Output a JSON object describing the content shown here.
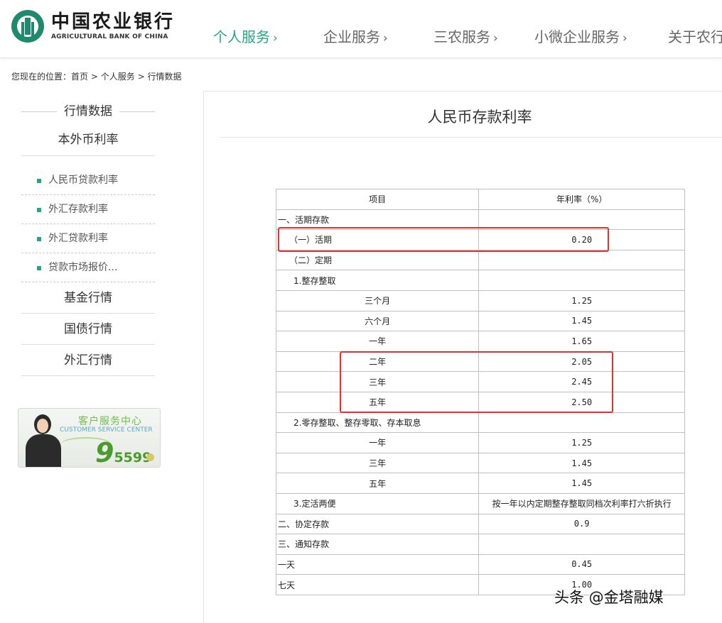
{
  "brand": {
    "name_cn": "中国农业银行",
    "name_en": "AGRICULTURAL BANK OF CHINA",
    "primary_color": "#27a38a",
    "logo_color": "#1f8a6d"
  },
  "nav": {
    "items": [
      {
        "label": "个人服务",
        "active": true
      },
      {
        "label": "企业服务",
        "active": false
      },
      {
        "label": "三农服务",
        "active": false
      },
      {
        "label": "小微企业服务",
        "active": false
      },
      {
        "label": "关于农行",
        "active": false
      }
    ],
    "chevron": "›"
  },
  "breadcrumb": {
    "prefix": "您现在的位置：",
    "path": [
      "首页",
      "个人服务",
      "行情数据"
    ],
    "separator": ">"
  },
  "sidebar": {
    "title": "行情数据",
    "section": "本外币利率",
    "sub_items": [
      "人民币贷款利率",
      "外汇存款利率",
      "外汇贷款利率",
      "贷款市场报价..."
    ],
    "categories": [
      "基金行情",
      "国债行情",
      "外汇行情"
    ]
  },
  "banner": {
    "title": "客户服务中心",
    "subtitle": "CUSTOMER SERVICE CENTER",
    "hotline_big": "9",
    "hotline_rest": "5599"
  },
  "main": {
    "title": "人民币存款利率"
  },
  "rates_table": {
    "headers": [
      "项目",
      "年利率（%）"
    ],
    "rows": [
      {
        "item": "一、活期存款",
        "rate": "",
        "level": 0
      },
      {
        "item": "（一）活期",
        "rate": "0.20",
        "level": 1
      },
      {
        "item": "（二）定期",
        "rate": "",
        "level": 1
      },
      {
        "item": "1.整存整取",
        "rate": "",
        "level": 2
      },
      {
        "item": "三个月",
        "rate": "1.25",
        "level": 3
      },
      {
        "item": "六个月",
        "rate": "1.45",
        "level": 3
      },
      {
        "item": "一年",
        "rate": "1.65",
        "level": 3
      },
      {
        "item": "二年",
        "rate": "2.05",
        "level": 3
      },
      {
        "item": "三年",
        "rate": "2.45",
        "level": 3
      },
      {
        "item": "五年",
        "rate": "2.50",
        "level": 3
      },
      {
        "item": "2.零存整取、整存零取、存本取息",
        "rate": "",
        "level": 2
      },
      {
        "item": "一年",
        "rate": "1.25",
        "level": 3
      },
      {
        "item": "三年",
        "rate": "1.45",
        "level": 3
      },
      {
        "item": "五年",
        "rate": "1.45",
        "level": 3
      },
      {
        "item": "3.定活两便",
        "rate": "按一年以内定期整存整取同档次利率打六折执行",
        "level": 2
      },
      {
        "item": "二、协定存款",
        "rate": "0.9",
        "level": 0
      },
      {
        "item": "三、通知存款",
        "rate": "",
        "level": 0
      },
      {
        "item": "一天",
        "rate": "0.45",
        "level": 0
      },
      {
        "item": "七天",
        "rate": "1.00",
        "level": 0
      }
    ]
  },
  "watermark": "头条 @金塔融媒",
  "highlight_color": "#e8312f"
}
